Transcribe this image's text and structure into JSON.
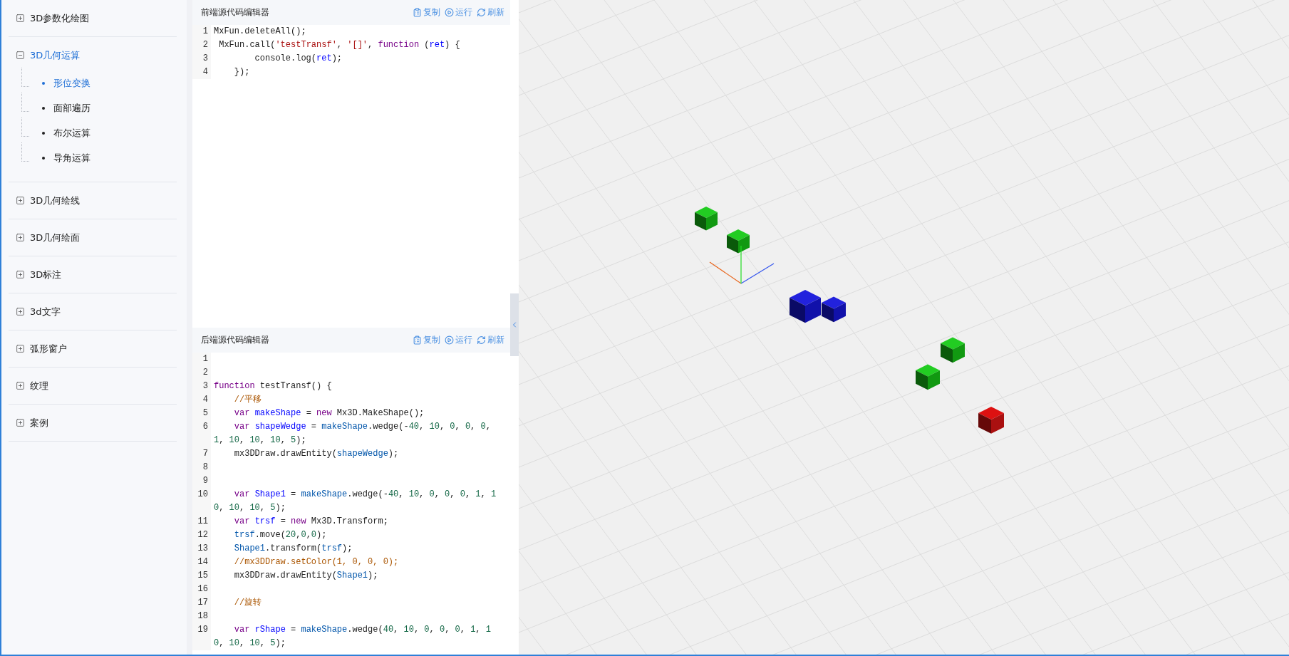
{
  "sidebar": {
    "groups": [
      {
        "label": "3D参数化绘图",
        "expanded": false,
        "selected": false
      },
      {
        "label": "3D几何运算",
        "expanded": true,
        "selected": true,
        "children": [
          {
            "label": "形位变换",
            "selected": true
          },
          {
            "label": "面部遍历",
            "selected": false
          },
          {
            "label": "布尔运算",
            "selected": false
          },
          {
            "label": "导角运算",
            "selected": false
          }
        ]
      },
      {
        "label": "3D几何绘线",
        "expanded": false,
        "selected": false
      },
      {
        "label": "3D几何绘面",
        "expanded": false,
        "selected": false
      },
      {
        "label": "3D标注",
        "expanded": false,
        "selected": false
      },
      {
        "label": "3d文字",
        "expanded": false,
        "selected": false
      },
      {
        "label": "弧形窗户",
        "expanded": false,
        "selected": false
      },
      {
        "label": "纹理",
        "expanded": false,
        "selected": false
      },
      {
        "label": "案例",
        "expanded": false,
        "selected": false
      }
    ]
  },
  "editors": [
    {
      "title": "前端源代码编辑器",
      "actions": [
        {
          "kind": "copy",
          "label": "复制"
        },
        {
          "kind": "run",
          "label": "运行"
        },
        {
          "kind": "refresh",
          "label": "刷新"
        }
      ],
      "lines": [
        {
          "number": "1",
          "tokens": [
            {
              "kind": "plain",
              "text": "MxFun.deleteAll();"
            }
          ]
        },
        {
          "number": "2",
          "tokens": [
            {
              "kind": "plain",
              "text": " MxFun.call("
            },
            {
              "kind": "str",
              "text": "'testTransf'"
            },
            {
              "kind": "plain",
              "text": ", "
            },
            {
              "kind": "str",
              "text": "'[]'"
            },
            {
              "kind": "plain",
              "text": ", "
            },
            {
              "kind": "kw",
              "text": "function"
            },
            {
              "kind": "plain",
              "text": " ("
            },
            {
              "kind": "def",
              "text": "ret"
            },
            {
              "kind": "plain",
              "text": ") {"
            }
          ]
        },
        {
          "number": "3",
          "tokens": [
            {
              "kind": "plain",
              "text": "        console.log("
            },
            {
              "kind": "def",
              "text": "ret"
            },
            {
              "kind": "plain",
              "text": ");"
            }
          ]
        },
        {
          "number": "4",
          "tokens": [
            {
              "kind": "plain",
              "text": "    });"
            }
          ]
        }
      ]
    },
    {
      "title": "后端源代码编辑器",
      "actions": [
        {
          "kind": "copy",
          "label": "复制"
        },
        {
          "kind": "run",
          "label": "运行"
        },
        {
          "kind": "refresh",
          "label": "刷新"
        }
      ],
      "lines": [
        {
          "number": "1"
        },
        {
          "number": "2"
        },
        {
          "number": "3",
          "tokens": [
            {
              "kind": "kw",
              "text": "function"
            },
            {
              "kind": "plain",
              "text": " testTransf() {"
            }
          ]
        },
        {
          "number": "4",
          "tokens": [
            {
              "kind": "comment",
              "text": "    //平移"
            }
          ]
        },
        {
          "number": "5",
          "tokens": [
            {
              "kind": "kw",
              "text": "    var "
            },
            {
              "kind": "def",
              "text": "makeShape"
            },
            {
              "kind": "plain",
              "text": " = "
            },
            {
              "kind": "kw",
              "text": "new"
            },
            {
              "kind": "plain",
              "text": " Mx3D.MakeShape();"
            }
          ]
        },
        {
          "number": "6",
          "tokens": [
            {
              "kind": "kw",
              "text": "    var "
            },
            {
              "kind": "def",
              "text": "shapeWedge"
            },
            {
              "kind": "plain",
              "text": " = "
            },
            {
              "kind": "var",
              "text": "makeShape"
            },
            {
              "kind": "plain",
              "text": ".wedge(-"
            },
            {
              "kind": "num",
              "text": "40"
            },
            {
              "kind": "plain",
              "text": ", "
            },
            {
              "kind": "num",
              "text": "10"
            },
            {
              "kind": "plain",
              "text": ", "
            },
            {
              "kind": "num",
              "text": "0"
            },
            {
              "kind": "plain",
              "text": ", "
            },
            {
              "kind": "num",
              "text": "0"
            },
            {
              "kind": "plain",
              "text": ", "
            },
            {
              "kind": "num",
              "text": "0"
            },
            {
              "kind": "plain",
              "text": ", "
            },
            {
              "kind": "num",
              "text": "1"
            },
            {
              "kind": "plain",
              "text": ", "
            },
            {
              "kind": "num",
              "text": "10"
            },
            {
              "kind": "plain",
              "text": ", "
            },
            {
              "kind": "num",
              "text": "10"
            },
            {
              "kind": "plain",
              "text": ", "
            },
            {
              "kind": "num",
              "text": "10"
            },
            {
              "kind": "plain",
              "text": ", "
            },
            {
              "kind": "num",
              "text": "5"
            },
            {
              "kind": "plain",
              "text": ");"
            }
          ]
        },
        {
          "number": "7",
          "tokens": [
            {
              "kind": "plain",
              "text": "    mx3DDraw.drawEntity("
            },
            {
              "kind": "var",
              "text": "shapeWedge"
            },
            {
              "kind": "plain",
              "text": ");"
            }
          ]
        },
        {
          "number": "8"
        },
        {
          "number": "9"
        },
        {
          "number": "10",
          "tokens": [
            {
              "kind": "kw",
              "text": "    var "
            },
            {
              "kind": "def",
              "text": "Shape1"
            },
            {
              "kind": "plain",
              "text": " = "
            },
            {
              "kind": "var",
              "text": "makeShape"
            },
            {
              "kind": "plain",
              "text": ".wedge(-"
            },
            {
              "kind": "num",
              "text": "40"
            },
            {
              "kind": "plain",
              "text": ", "
            },
            {
              "kind": "num",
              "text": "10"
            },
            {
              "kind": "plain",
              "text": ", "
            },
            {
              "kind": "num",
              "text": "0"
            },
            {
              "kind": "plain",
              "text": ", "
            },
            {
              "kind": "num",
              "text": "0"
            },
            {
              "kind": "plain",
              "text": ", "
            },
            {
              "kind": "num",
              "text": "0"
            },
            {
              "kind": "plain",
              "text": ", "
            },
            {
              "kind": "num",
              "text": "1"
            },
            {
              "kind": "plain",
              "text": ", "
            },
            {
              "kind": "num",
              "text": "10"
            },
            {
              "kind": "plain",
              "text": ", "
            },
            {
              "kind": "num",
              "text": "10"
            },
            {
              "kind": "plain",
              "text": ", "
            },
            {
              "kind": "num",
              "text": "10"
            },
            {
              "kind": "plain",
              "text": ", "
            },
            {
              "kind": "num",
              "text": "5"
            },
            {
              "kind": "plain",
              "text": ");"
            }
          ]
        },
        {
          "number": "11",
          "tokens": [
            {
              "kind": "kw",
              "text": "    var "
            },
            {
              "kind": "def",
              "text": "trsf"
            },
            {
              "kind": "plain",
              "text": " = "
            },
            {
              "kind": "kw",
              "text": "new"
            },
            {
              "kind": "plain",
              "text": " Mx3D.Transform;"
            }
          ]
        },
        {
          "number": "12",
          "tokens": [
            {
              "kind": "var",
              "text": "    trsf"
            },
            {
              "kind": "plain",
              "text": ".move("
            },
            {
              "kind": "num",
              "text": "20"
            },
            {
              "kind": "plain",
              "text": ","
            },
            {
              "kind": "num",
              "text": "0"
            },
            {
              "kind": "plain",
              "text": ","
            },
            {
              "kind": "num",
              "text": "0"
            },
            {
              "kind": "plain",
              "text": ");"
            }
          ]
        },
        {
          "number": "13",
          "tokens": [
            {
              "kind": "var",
              "text": "    Shape1"
            },
            {
              "kind": "plain",
              "text": ".transform("
            },
            {
              "kind": "var",
              "text": "trsf"
            },
            {
              "kind": "plain",
              "text": ");"
            }
          ]
        },
        {
          "number": "14",
          "tokens": [
            {
              "kind": "comment",
              "text": "    //mx3DDraw.setColor(1, 0, 0, 0);"
            }
          ]
        },
        {
          "number": "15",
          "tokens": [
            {
              "kind": "plain",
              "text": "    mx3DDraw.drawEntity("
            },
            {
              "kind": "var",
              "text": "Shape1"
            },
            {
              "kind": "plain",
              "text": ");"
            }
          ]
        },
        {
          "number": "16"
        },
        {
          "number": "17",
          "tokens": [
            {
              "kind": "comment",
              "text": "    //旋转"
            }
          ]
        },
        {
          "number": "18"
        },
        {
          "number": "19",
          "tokens": [
            {
              "kind": "kw",
              "text": "    var "
            },
            {
              "kind": "def",
              "text": "rShape"
            },
            {
              "kind": "plain",
              "text": " = "
            },
            {
              "kind": "var",
              "text": "makeShape"
            },
            {
              "kind": "plain",
              "text": ".wedge("
            },
            {
              "kind": "num",
              "text": "40"
            },
            {
              "kind": "plain",
              "text": ", "
            },
            {
              "kind": "num",
              "text": "10"
            },
            {
              "kind": "plain",
              "text": ", "
            },
            {
              "kind": "num",
              "text": "0"
            },
            {
              "kind": "plain",
              "text": ", "
            },
            {
              "kind": "num",
              "text": "0"
            },
            {
              "kind": "plain",
              "text": ", "
            },
            {
              "kind": "num",
              "text": "0"
            },
            {
              "kind": "plain",
              "text": ", "
            },
            {
              "kind": "num",
              "text": "1"
            },
            {
              "kind": "plain",
              "text": ", "
            },
            {
              "kind": "num",
              "text": "10"
            },
            {
              "kind": "plain",
              "text": ", "
            },
            {
              "kind": "num",
              "text": "10"
            },
            {
              "kind": "plain",
              "text": ", "
            },
            {
              "kind": "num",
              "text": "10"
            },
            {
              "kind": "plain",
              "text": ", "
            },
            {
              "kind": "num",
              "text": "5"
            },
            {
              "kind": "plain",
              "text": ");"
            }
          ]
        }
      ]
    }
  ]
}
